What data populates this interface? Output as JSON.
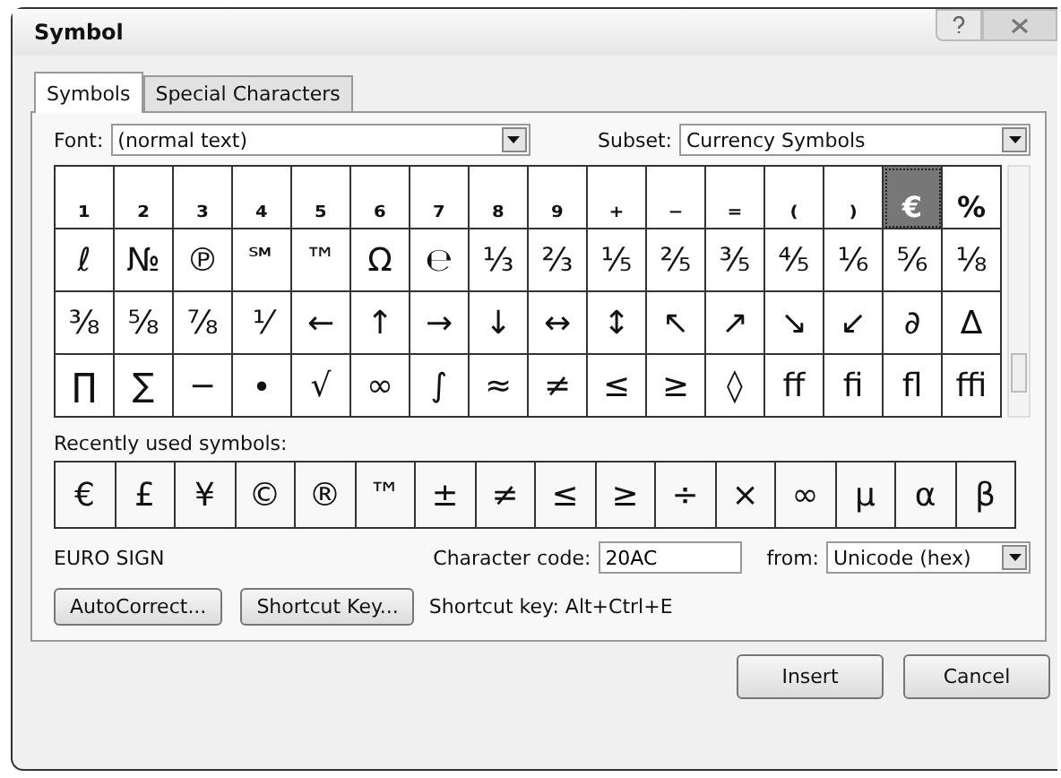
{
  "window": {
    "title": "Symbol"
  },
  "tabs": [
    {
      "label": "Symbols",
      "selected": true
    },
    {
      "label": "Special Characters",
      "selected": false
    }
  ],
  "font": {
    "label": "Font:",
    "value": "(normal text)"
  },
  "subset": {
    "label": "Subset:",
    "value": "Currency Symbols"
  },
  "symbol_grid": [
    [
      {
        "char": "₁",
        "selected": false
      },
      {
        "char": "₂",
        "selected": false
      },
      {
        "char": "₃",
        "selected": false
      },
      {
        "char": "₄",
        "selected": false
      },
      {
        "char": "₅",
        "selected": false
      },
      {
        "char": "₆",
        "selected": false
      },
      {
        "char": "₇",
        "selected": false
      },
      {
        "char": "₈",
        "selected": false
      },
      {
        "char": "₉",
        "selected": false
      },
      {
        "char": "₊",
        "selected": false
      },
      {
        "char": "₋",
        "selected": false
      },
      {
        "char": "₌",
        "selected": false
      },
      {
        "char": "₍",
        "selected": false
      },
      {
        "char": "₎",
        "selected": false
      },
      {
        "char": "€",
        "selected": true
      },
      {
        "char": "%",
        "selected": false
      }
    ],
    [
      {
        "char": "ℓ",
        "selected": false
      },
      {
        "char": "№",
        "selected": false
      },
      {
        "char": "℗",
        "selected": false
      },
      {
        "char": "℠",
        "selected": false
      },
      {
        "char": "™",
        "selected": false
      },
      {
        "char": "Ω",
        "selected": false
      },
      {
        "char": "℮",
        "selected": false
      },
      {
        "char": "⅓",
        "selected": false
      },
      {
        "char": "⅔",
        "selected": false
      },
      {
        "char": "⅕",
        "selected": false
      },
      {
        "char": "⅖",
        "selected": false
      },
      {
        "char": "⅗",
        "selected": false
      },
      {
        "char": "⅘",
        "selected": false
      },
      {
        "char": "⅙",
        "selected": false
      },
      {
        "char": "⅚",
        "selected": false
      },
      {
        "char": "⅛",
        "selected": false
      }
    ],
    [
      {
        "char": "⅜",
        "selected": false
      },
      {
        "char": "⅝",
        "selected": false
      },
      {
        "char": "⅞",
        "selected": false
      },
      {
        "char": "⅟",
        "selected": false
      },
      {
        "char": "←",
        "selected": false
      },
      {
        "char": "↑",
        "selected": false
      },
      {
        "char": "→",
        "selected": false
      },
      {
        "char": "↓",
        "selected": false
      },
      {
        "char": "↔",
        "selected": false
      },
      {
        "char": "↕",
        "selected": false
      },
      {
        "char": "↖",
        "selected": false
      },
      {
        "char": "↗",
        "selected": false
      },
      {
        "char": "↘",
        "selected": false
      },
      {
        "char": "↙",
        "selected": false
      },
      {
        "char": "∂",
        "selected": false
      },
      {
        "char": "∆",
        "selected": false
      }
    ],
    [
      {
        "char": "∏",
        "selected": false
      },
      {
        "char": "∑",
        "selected": false
      },
      {
        "char": "−",
        "selected": false
      },
      {
        "char": "∙",
        "selected": false
      },
      {
        "char": "√",
        "selected": false
      },
      {
        "char": "∞",
        "selected": false
      },
      {
        "char": "∫",
        "selected": false
      },
      {
        "char": "≈",
        "selected": false
      },
      {
        "char": "≠",
        "selected": false
      },
      {
        "char": "≤",
        "selected": false
      },
      {
        "char": "≥",
        "selected": false
      },
      {
        "char": "◊",
        "selected": false
      },
      {
        "char": "ﬀ",
        "selected": false
      },
      {
        "char": "ﬁ",
        "selected": false
      },
      {
        "char": "ﬂ",
        "selected": false
      },
      {
        "char": "ﬃ",
        "selected": false
      }
    ]
  ],
  "recently_used": {
    "label": "Recently used symbols:",
    "symbols": [
      "€",
      "£",
      "¥",
      "©",
      "®",
      "™",
      "±",
      "≠",
      "≤",
      "≥",
      "÷",
      "×",
      "∞",
      "µ",
      "α",
      "β"
    ]
  },
  "character_name": "EURO SIGN",
  "character_code": {
    "label": "Character code:",
    "value": "20AC"
  },
  "from": {
    "label": "from:",
    "value": "Unicode (hex)"
  },
  "buttons": [
    "AutoCorrect...",
    "Shortcut Key..."
  ],
  "shortcut_text": "Shortcut key: Alt+Ctrl+E",
  "dialog_buttons": [
    "Insert",
    "Cancel"
  ]
}
